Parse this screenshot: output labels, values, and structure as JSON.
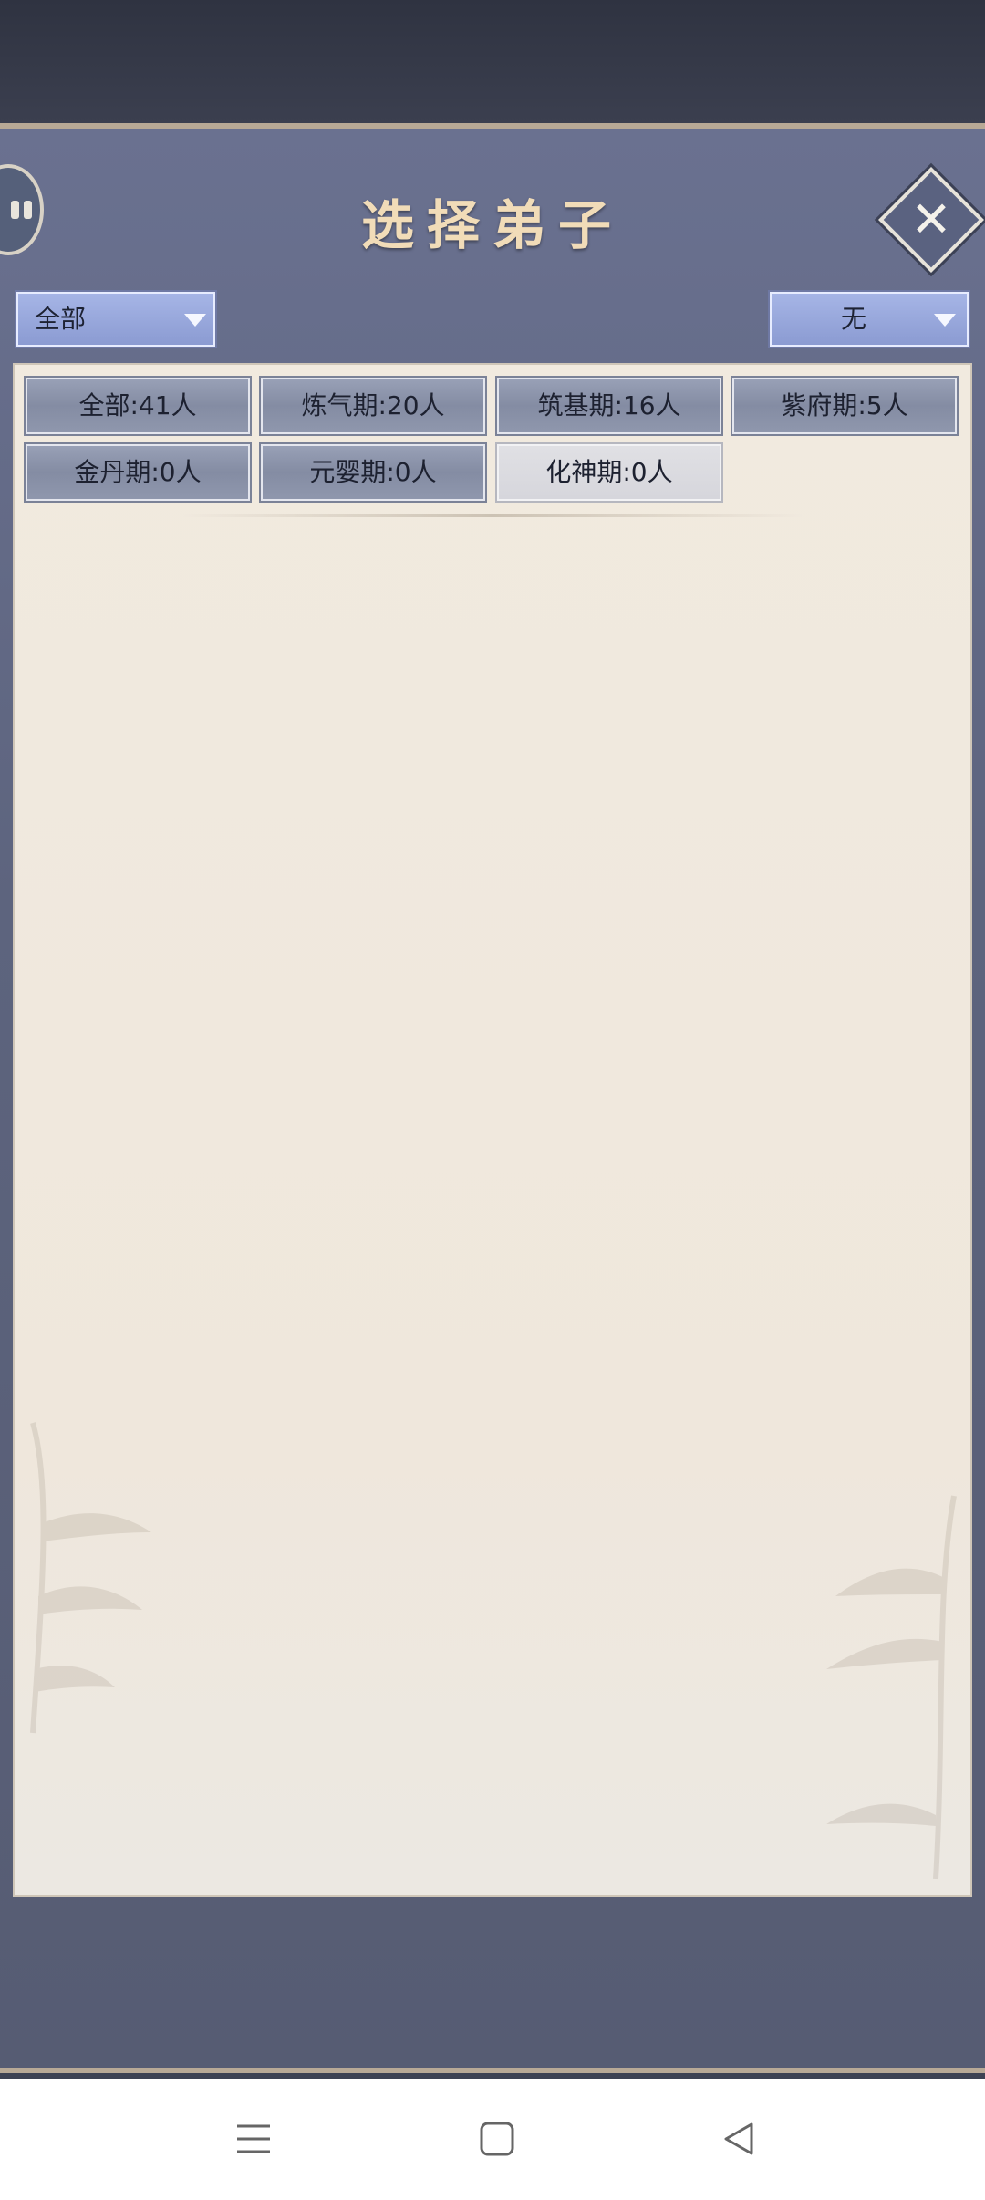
{
  "dialog": {
    "title": "选择弟子",
    "filter_left": {
      "selected": "全部"
    },
    "filter_right": {
      "selected": "无"
    }
  },
  "realm_filters": [
    {
      "label": "全部:41人",
      "style": "normal"
    },
    {
      "label": "炼气期:20人",
      "style": "normal"
    },
    {
      "label": "筑基期:16人",
      "style": "normal"
    },
    {
      "label": "紫府期:5人",
      "style": "normal"
    },
    {
      "label": "金丹期:0人",
      "style": "normal"
    },
    {
      "label": "元婴期:0人",
      "style": "normal"
    },
    {
      "label": "化神期:0人",
      "style": "light"
    }
  ],
  "icons": {
    "close": "close-icon",
    "side_badge": "pause-icon",
    "nav_menu": "menu-icon",
    "nav_home": "home-icon",
    "nav_back": "back-icon"
  },
  "colors": {
    "title": "#f1dcb8",
    "panel": "#5d647e",
    "content_bg": "#f1eadf",
    "dropdown": "#a6b5e6"
  }
}
